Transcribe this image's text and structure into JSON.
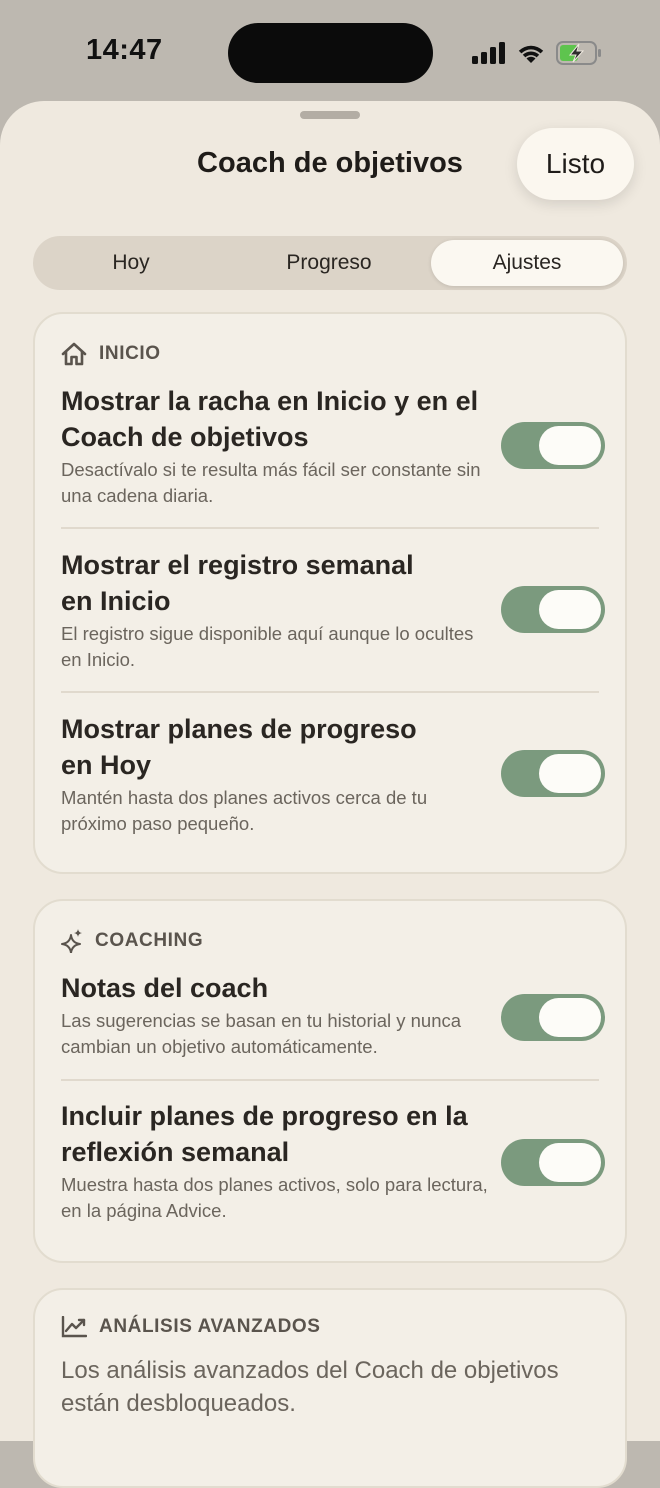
{
  "status_bar": {
    "time": "14:47"
  },
  "sheet": {
    "title": "Coach de objetivos",
    "done_label": "Listo"
  },
  "tabs": [
    {
      "label": "Hoy",
      "active": false
    },
    {
      "label": "Progreso",
      "active": false
    },
    {
      "label": "Ajustes",
      "active": true
    }
  ],
  "sections": {
    "inicio": {
      "header": "INICIO",
      "icon": "home-icon",
      "rows": [
        {
          "title": "Mostrar la racha en Inicio y en el Coach de objetivos",
          "title_lines": [
            "Mostrar la racha en Inicio y en el",
            "Coach de objetivos"
          ],
          "description": "Desactívalo si te resulta más fácil ser constante sin una cadena diaria.",
          "enabled": true
        },
        {
          "title": "Mostrar el registro semanal en Inicio",
          "title_lines": [
            "Mostrar el registro semanal",
            "en Inicio"
          ],
          "description": "El registro sigue disponible aquí aunque lo ocultes en Inicio.",
          "enabled": true
        },
        {
          "title": "Mostrar planes de progreso en Hoy",
          "title_lines": [
            "Mostrar planes de progreso",
            "en Hoy"
          ],
          "description": "Mantén hasta dos planes activos cerca de tu próximo paso pequeño.",
          "enabled": true
        }
      ]
    },
    "coaching": {
      "header": "COACHING",
      "icon": "sparkles-icon",
      "rows": [
        {
          "title": "Notas del coach",
          "description": "Las sugerencias se basan en tu historial y nunca cambian un objetivo automáticamente.",
          "enabled": true
        },
        {
          "title": "Incluir planes de progreso en la reflexión semanal",
          "title_lines": [
            "Incluir planes de progreso en la",
            "reflexión semanal"
          ],
          "description": "Muestra hasta dos planes activos, solo para lectura, en la página Advice.",
          "enabled": true
        }
      ]
    },
    "analisis": {
      "header": "ANÁLISIS AVANZADOS",
      "icon": "chart-line-icon",
      "text": "Los análisis avanzados del Coach de objetivos están desbloqueados."
    }
  },
  "colors": {
    "toggle_on": "#7b9a7e",
    "sheet_background": "#efe9df",
    "card_background": "#f3efe7"
  }
}
